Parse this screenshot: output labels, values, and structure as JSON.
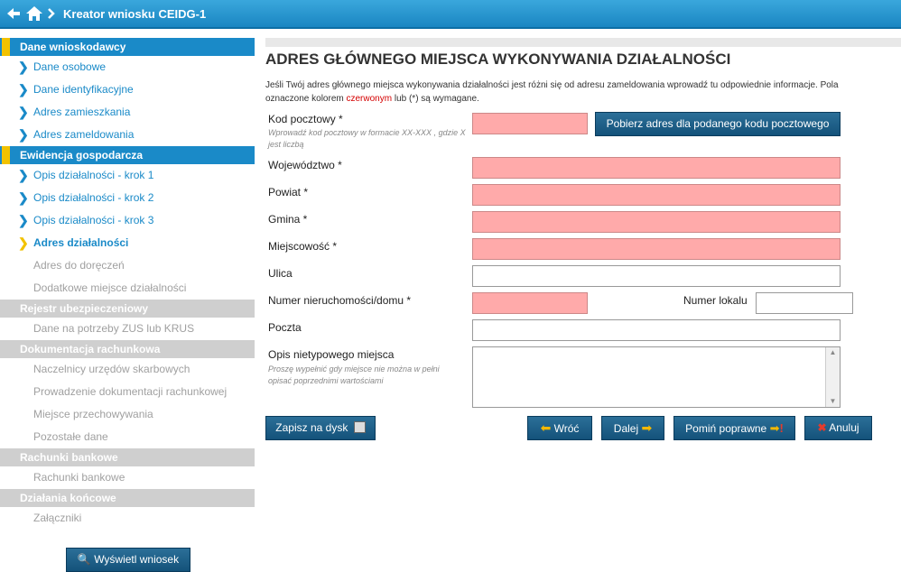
{
  "header": {
    "title": "Kreator wniosku CEIDG-1",
    "back_icon": "arrow-left-icon",
    "home_icon": "home-icon"
  },
  "sidebar": {
    "sections": [
      {
        "label": "Dane wnioskodawcy",
        "state": "active",
        "items": [
          {
            "label": "Dane osobowe",
            "state": "link"
          },
          {
            "label": "Dane identyfikacyjne",
            "state": "link"
          },
          {
            "label": "Adres zamieszkania",
            "state": "link"
          },
          {
            "label": "Adres zameldowania",
            "state": "link"
          }
        ]
      },
      {
        "label": "Ewidencja gospodarcza",
        "state": "active",
        "items": [
          {
            "label": "Opis działalności - krok 1",
            "state": "link"
          },
          {
            "label": "Opis działalności - krok 2",
            "state": "link"
          },
          {
            "label": "Opis działalności - krok 3",
            "state": "link"
          },
          {
            "label": "Adres działalności",
            "state": "current"
          },
          {
            "label": "Adres do doręczeń",
            "state": "disabled"
          },
          {
            "label": "Dodatkowe miejsce działalności",
            "state": "disabled"
          }
        ]
      },
      {
        "label": "Rejestr ubezpieczeniowy",
        "state": "inactive",
        "items": [
          {
            "label": "Dane na potrzeby ZUS lub KRUS",
            "state": "disabled"
          }
        ]
      },
      {
        "label": "Dokumentacja rachunkowa",
        "state": "inactive",
        "items": [
          {
            "label": "Naczelnicy urzędów skarbowych",
            "state": "disabled"
          },
          {
            "label": "Prowadzenie dokumentacji rachunkowej",
            "state": "disabled"
          },
          {
            "label": "Miejsce przechowywania",
            "state": "disabled"
          },
          {
            "label": "Pozostałe dane",
            "state": "disabled"
          }
        ]
      },
      {
        "label": "Rachunki bankowe",
        "state": "inactive",
        "items": [
          {
            "label": "Rachunki bankowe",
            "state": "disabled"
          }
        ]
      },
      {
        "label": "Działania końcowe",
        "state": "inactive",
        "items": [
          {
            "label": "Załączniki",
            "state": "disabled"
          }
        ]
      }
    ],
    "preview_button": "Wyświetl wniosek"
  },
  "main": {
    "title": "ADRES GŁÓWNEGO MIEJSCA WYKONYWANIA DZIAŁALNOŚCI",
    "intro_1": "Jeśli Twój adres głównego miejsca wykonywania działalności jest różni się od adresu zameldowania wprowadź tu odpowiednie informacje. Pola",
    "intro_2a": "oznaczone kolorem ",
    "intro_red": "czerwonym",
    "intro_2b": " lub (*) są wymagane.",
    "fields": {
      "postal_code": {
        "label": "Kod pocztowy *",
        "hint": "Wprowadź kod pocztowy w formacie XX-XXX , gdzie X jest liczbą",
        "value": ""
      },
      "fetch_button": "Pobierz adres dla podanego kodu pocztowego",
      "voivodeship": {
        "label": "Województwo *",
        "value": ""
      },
      "county": {
        "label": "Powiat *",
        "value": ""
      },
      "commune": {
        "label": "Gmina *",
        "value": ""
      },
      "city": {
        "label": "Miejscowość *",
        "value": ""
      },
      "street": {
        "label": "Ulica",
        "value": ""
      },
      "building": {
        "label": "Numer nieruchomości/domu *",
        "value": ""
      },
      "apartment": {
        "label": "Numer lokalu",
        "value": ""
      },
      "post_office": {
        "label": "Poczta",
        "value": ""
      },
      "unusual_place": {
        "label": "Opis nietypowego miejsca",
        "hint": "Proszę wypełnić gdy miejsce nie można w pełni opisać poprzednimi wartościami",
        "value": ""
      }
    },
    "buttons": {
      "save": "Zapisz na dysk",
      "back": "Wróć",
      "next": "Dalej",
      "skip": "Pomiń poprawne",
      "cancel": "Anuluj"
    }
  }
}
